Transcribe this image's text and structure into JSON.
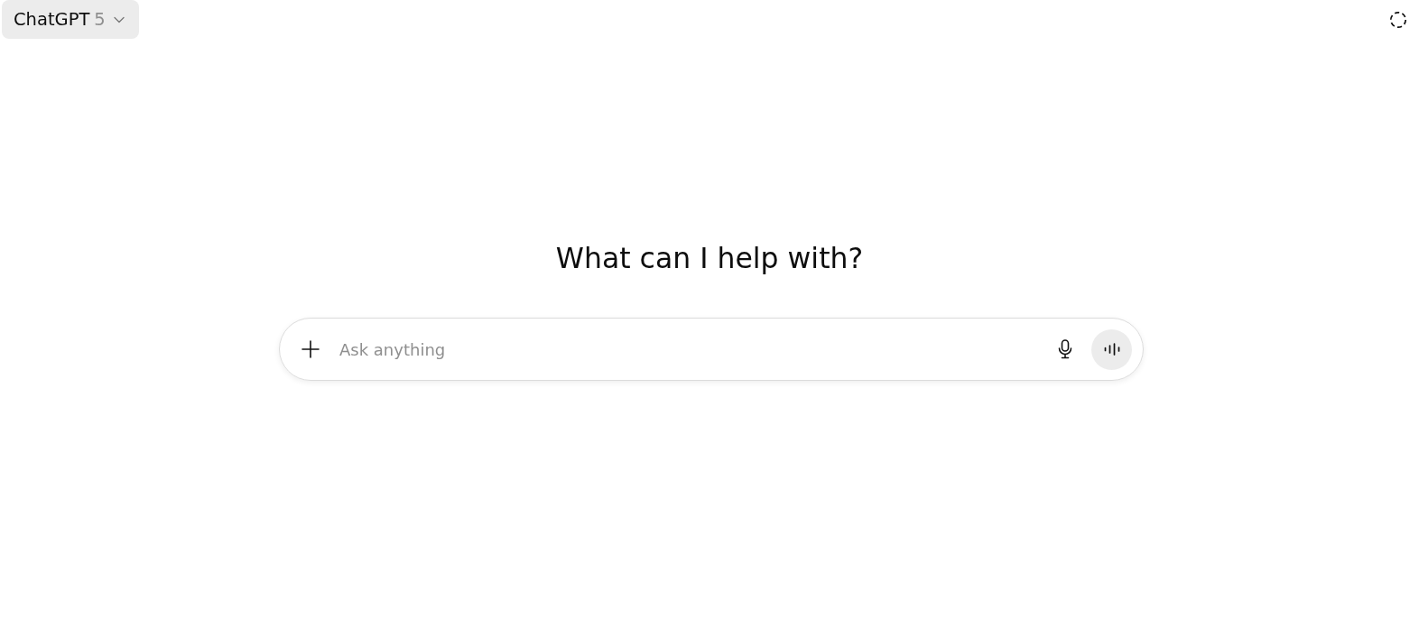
{
  "model_selector": {
    "name": "ChatGPT",
    "version": "5"
  },
  "heading": "What can I help with?",
  "composer": {
    "placeholder": "Ask anything"
  }
}
